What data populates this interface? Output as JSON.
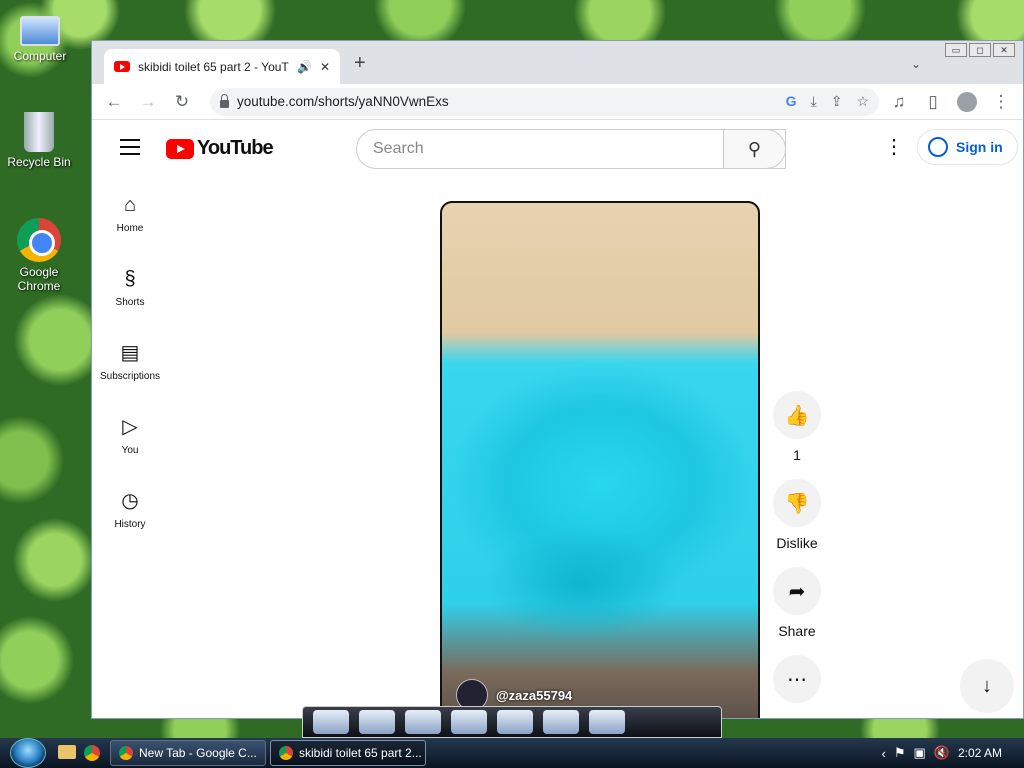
{
  "desktop": {
    "icons": [
      {
        "label": "Computer"
      },
      {
        "label": "Recycle Bin"
      },
      {
        "label": "Google Chrome"
      }
    ]
  },
  "browser": {
    "tab": {
      "title": "skibidi toilet 65 part 2 - YouT",
      "audio_icon": "speaker-icon",
      "close": "✕"
    },
    "new_tab": "+",
    "url": "youtube.com/shorts/yaNN0VwnExs",
    "window_controls": [
      "▭",
      "◻",
      "✕"
    ]
  },
  "youtube": {
    "logo_text": "YouTube",
    "search_placeholder": "Search",
    "sign_in": "Sign in",
    "guide": [
      {
        "label": "Home",
        "icon": "home-icon"
      },
      {
        "label": "Shorts",
        "icon": "shorts-icon"
      },
      {
        "label": "Subscriptions",
        "icon": "subscriptions-icon"
      },
      {
        "label": "You",
        "icon": "you-icon"
      },
      {
        "label": "History",
        "icon": "history-icon"
      }
    ],
    "short": {
      "channel": "@zaza55794"
    },
    "actions": {
      "like_count": "1",
      "dislike": "Dislike",
      "share": "Share"
    }
  },
  "taskbar": {
    "buttons": [
      {
        "label": "New Tab - Google C..."
      },
      {
        "label": "skibidi toilet 65 part 2..."
      }
    ],
    "clock": "2:02 AM"
  },
  "colors": {
    "youtube_red": "#ff0000",
    "link_blue": "#065fd4",
    "taskbar": "#0b1523"
  }
}
